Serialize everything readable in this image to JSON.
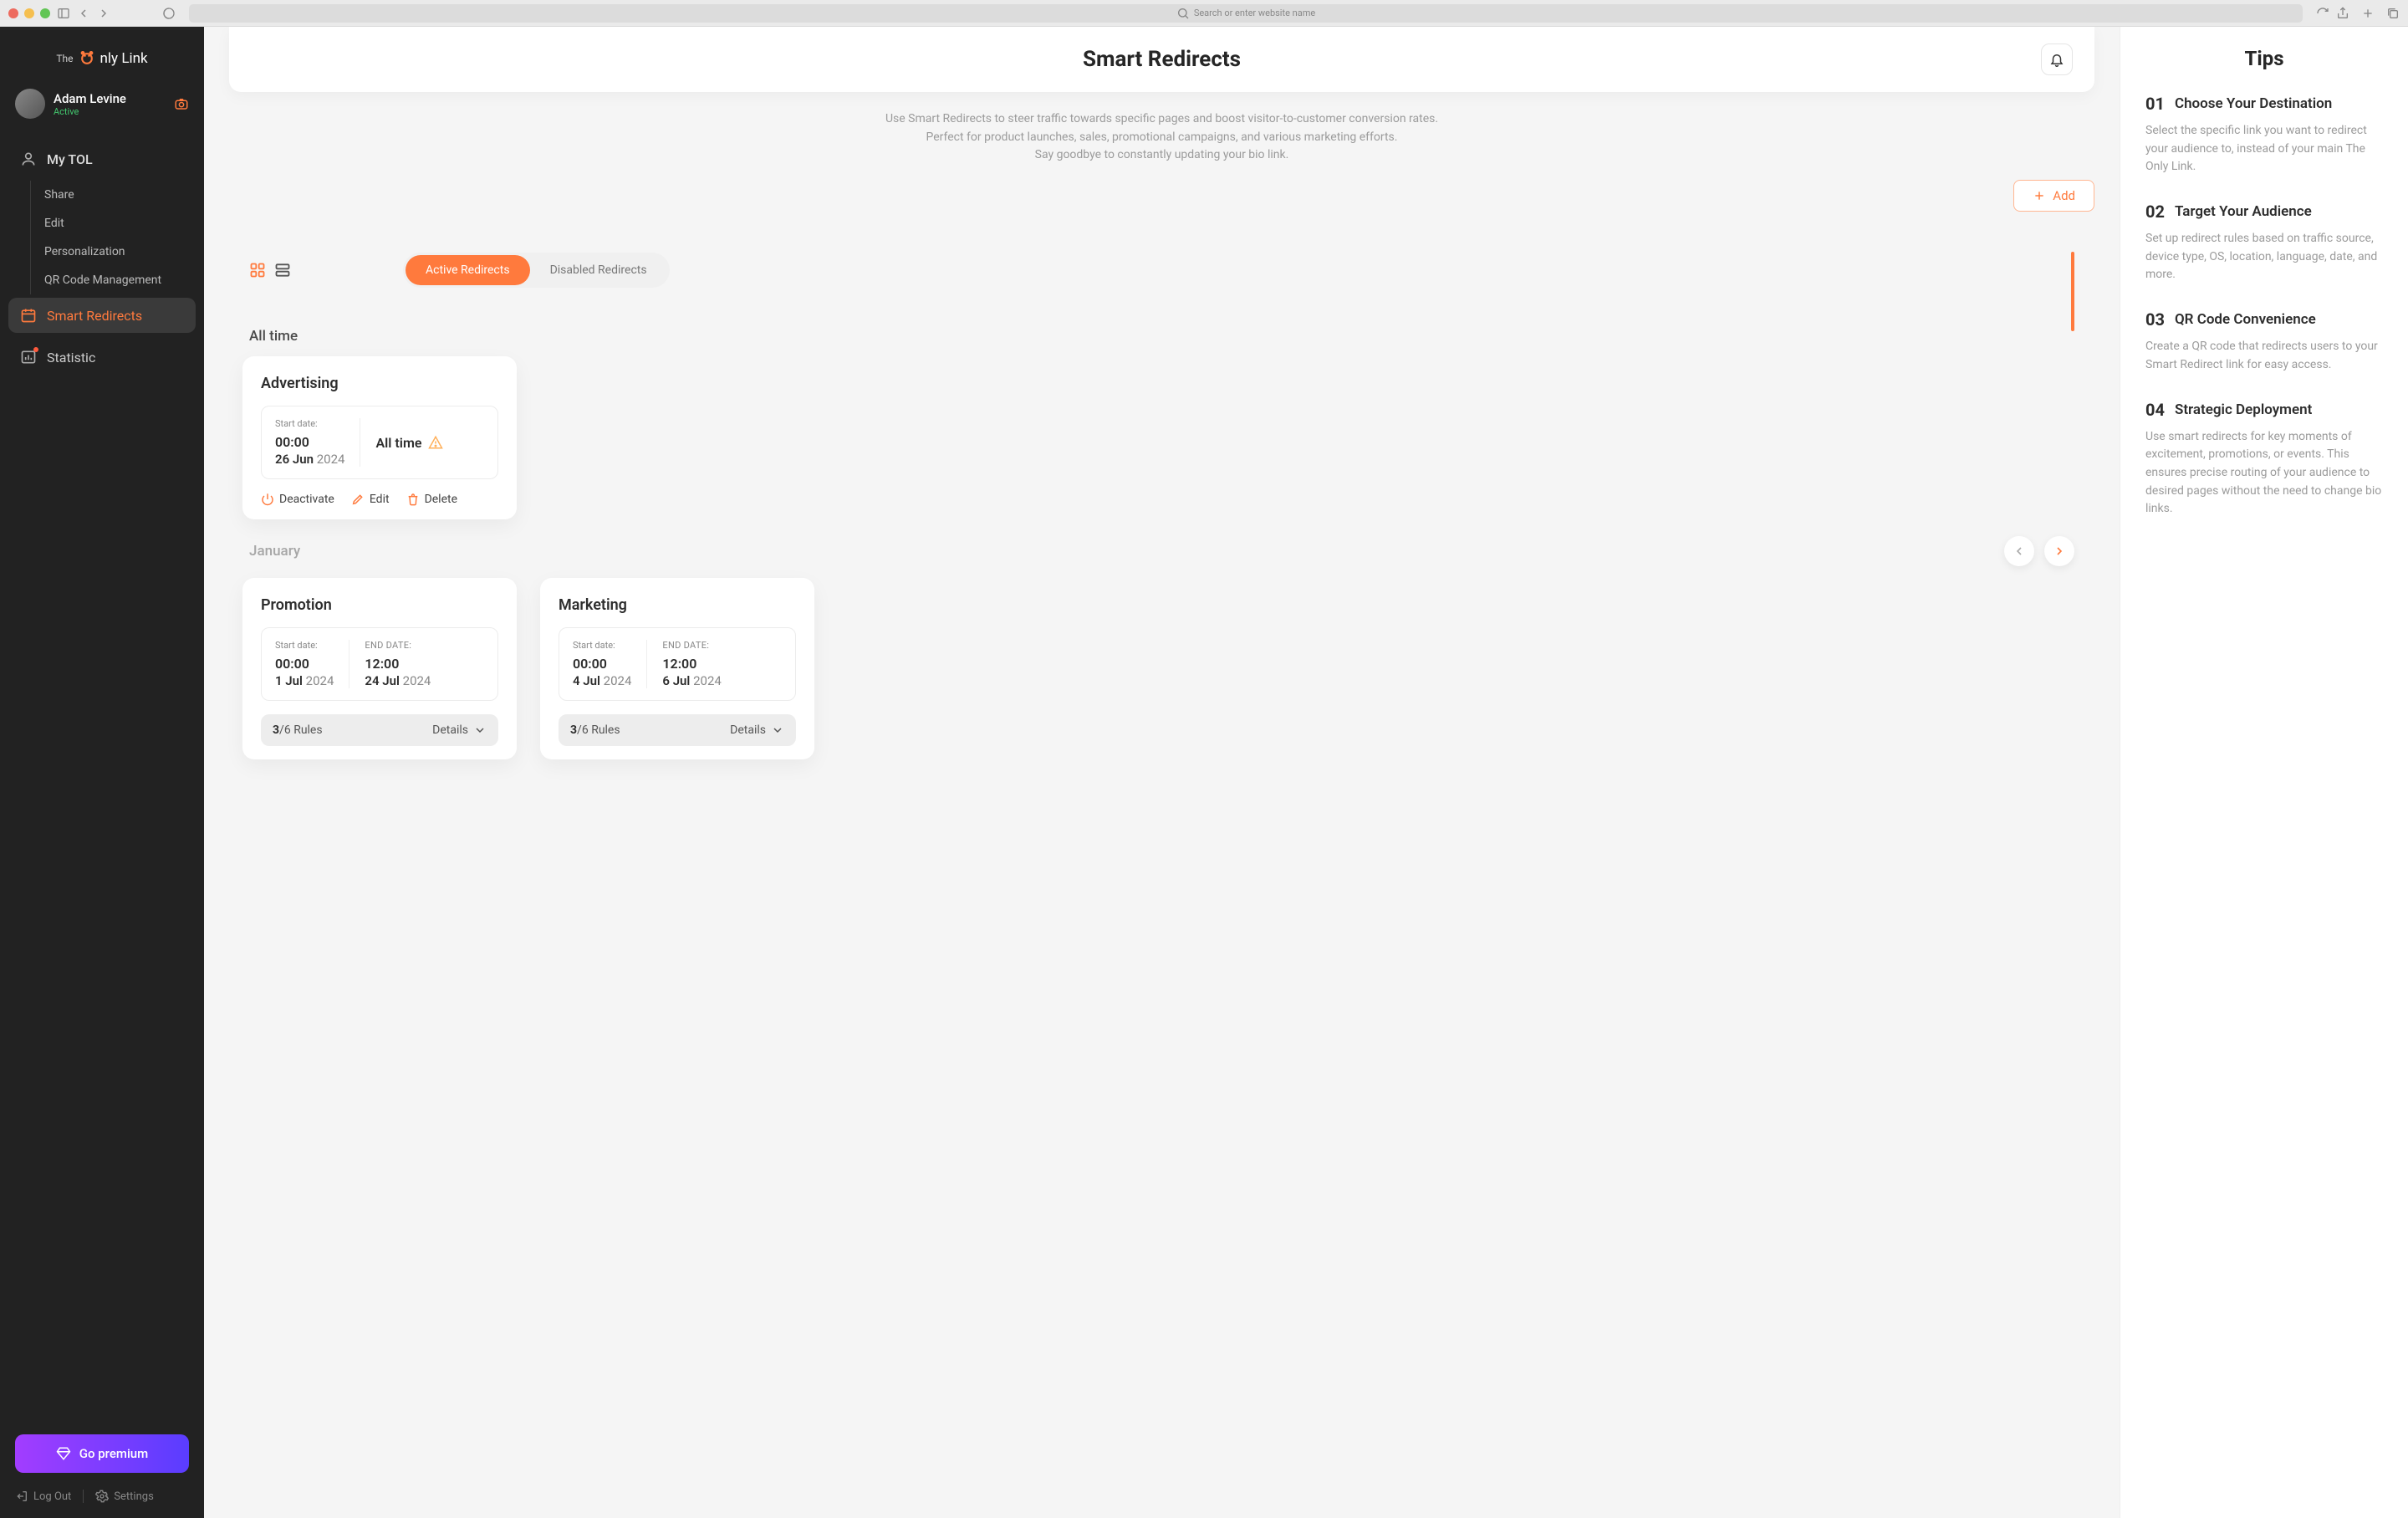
{
  "chrome": {
    "placeholder": "Search or enter website name"
  },
  "brand": {
    "pre": "The",
    "o": "O",
    "rest": "nly Link"
  },
  "user": {
    "name": "Adam Levine",
    "status": "Active"
  },
  "sidebar": {
    "mytol": "My TOL",
    "items": {
      "share": "Share",
      "edit": "Edit",
      "personalization": "Personalization",
      "qr": "QR Code Management"
    },
    "smart": "Smart Redirects",
    "stat": "Statistic",
    "premium": "Go premium",
    "logout": "Log Out",
    "settings": "Settings"
  },
  "header": {
    "title": "Smart Redirects"
  },
  "intro": {
    "l1": "Use Smart Redirects to steer traffic towards specific pages and boost visitor-to-customer conversion rates.",
    "l2": "Perfect for product launches, sales, promotional campaigns, and various marketing efforts.",
    "l3": "Say goodbye to constantly updating your bio link."
  },
  "add_label": "Add",
  "tabs": {
    "active": "Active Redirects",
    "disabled": "Disabled Redirects"
  },
  "sections": {
    "alltime": "All time",
    "january": "January"
  },
  "labels": {
    "start": "Start date:",
    "end": "END DATE:",
    "alltime": "All time",
    "details": "Details",
    "rules_word": "Rules"
  },
  "actions": {
    "deactivate": "Deactivate",
    "edit": "Edit",
    "delete": "Delete"
  },
  "cards": {
    "advertising": {
      "title": "Advertising",
      "start_time": "00:00",
      "start_day": "26 Jun",
      "start_year": "2024"
    },
    "promotion": {
      "title": "Promotion",
      "start_time": "00:00",
      "start_day": "1 Jul",
      "start_year": "2024",
      "end_time": "12:00",
      "end_day": "24 Jul",
      "end_year": "2024",
      "rules_used": "3",
      "rules_total": "/6"
    },
    "marketing": {
      "title": "Marketing",
      "start_time": "00:00",
      "start_day": "4 Jul",
      "start_year": "2024",
      "end_time": "12:00",
      "end_day": "6 Jul",
      "end_year": "2024",
      "rules_used": "3",
      "rules_total": "/6"
    }
  },
  "tips": {
    "title": "Tips",
    "items": [
      {
        "num": "01",
        "title": "Choose Your Destination",
        "body": "Select the specific link you want to redirect your audience to, instead of your main The Only Link."
      },
      {
        "num": "02",
        "title": "Target Your Audience",
        "body": "Set up redirect rules based on traffic source, device type, OS, location, language, date, and more."
      },
      {
        "num": "03",
        "title": "QR Code Convenience",
        "body": "Create a QR code that redirects users to your Smart Redirect link for easy access."
      },
      {
        "num": "04",
        "title": "Strategic Deployment",
        "body": "Use smart redirects for key moments of excitement, promotions, or events. This ensures precise routing of your audience to desired pages without the need to change bio links."
      }
    ]
  }
}
